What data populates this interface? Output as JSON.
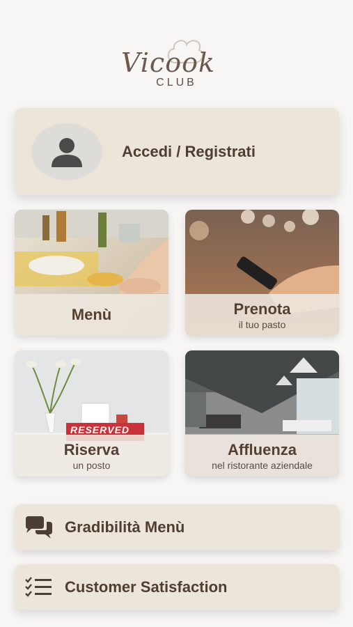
{
  "logo": {
    "script": "Vicook",
    "sub": "CLUB",
    "icon": "chef-hat-icon"
  },
  "login": {
    "label": "Accedi / Registrati",
    "icon": "user-icon"
  },
  "tiles": [
    {
      "title": "Menù",
      "subtitle": ""
    },
    {
      "title": "Prenota",
      "subtitle": "il tuo pasto"
    },
    {
      "title": "Riserva",
      "subtitle": "un posto",
      "sign": "RESERVED"
    },
    {
      "title": "Affluenza",
      "subtitle": "nel ristorante aziendale"
    }
  ],
  "actions": [
    {
      "label": "Gradibilità Menù",
      "icon": "chat-bubbles-icon"
    },
    {
      "label": "Customer Satisfaction",
      "icon": "checklist-icon"
    }
  ],
  "colors": {
    "background": "#f7f6f4",
    "card": "#ece5da",
    "text": "#4f3e31"
  }
}
